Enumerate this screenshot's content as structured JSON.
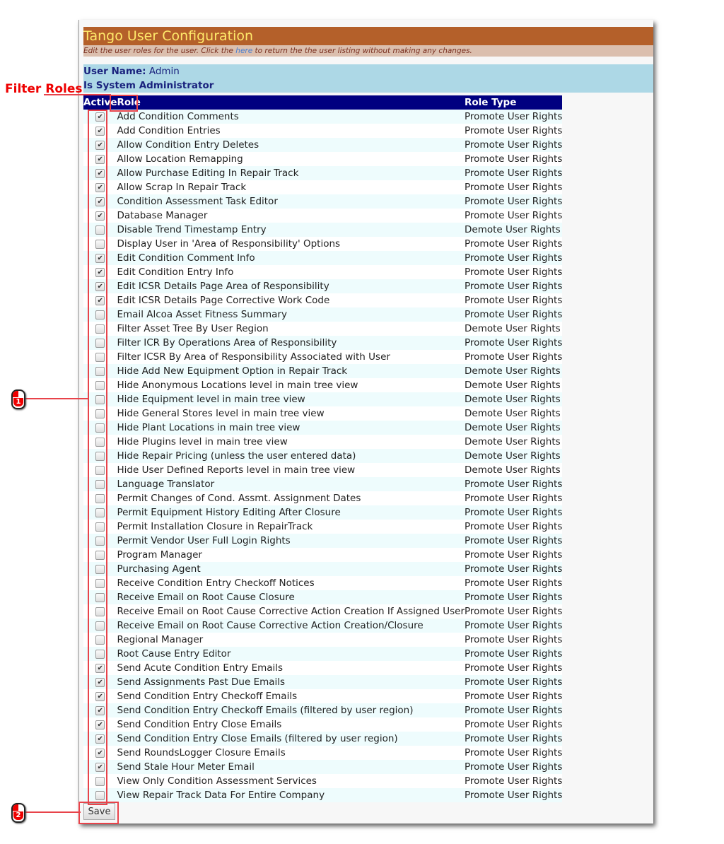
{
  "header": {
    "title": "Tango User Configuration",
    "subtitle_before": "Edit the user roles for the user. Click the ",
    "subtitle_link": "here",
    "subtitle_after": " to return the the user listing without making any changes."
  },
  "user": {
    "name_label": "User Name:",
    "name_value": "Admin",
    "sysadmin": "Is System Administrator"
  },
  "table": {
    "headers": [
      "Active",
      "Role",
      "Role Type"
    ],
    "rows": [
      [
        "Add Condition Comments",
        "Promote User Rights",
        true
      ],
      [
        "Add Condition Entries",
        "Promote User Rights",
        true
      ],
      [
        "Allow Condition Entry Deletes",
        "Promote User Rights",
        true
      ],
      [
        "Allow Location Remapping",
        "Promote User Rights",
        true
      ],
      [
        "Allow Purchase Editing In Repair Track",
        "Promote User Rights",
        true
      ],
      [
        "Allow Scrap In Repair Track",
        "Promote User Rights",
        true
      ],
      [
        "Condition Assessment Task Editor",
        "Promote User Rights",
        true
      ],
      [
        "Database Manager",
        "Promote User Rights",
        true
      ],
      [
        "Disable Trend Timestamp Entry",
        "Demote User Rights",
        false
      ],
      [
        "Display User in 'Area of Responsibility' Options",
        "Promote User Rights",
        false
      ],
      [
        "Edit Condition Comment Info",
        "Promote User Rights",
        true
      ],
      [
        "Edit Condition Entry Info",
        "Promote User Rights",
        true
      ],
      [
        "Edit ICSR Details Page Area of Responsibility",
        "Promote User Rights",
        true
      ],
      [
        "Edit ICSR Details Page Corrective Work Code",
        "Promote User Rights",
        true
      ],
      [
        "Email Alcoa Asset Fitness Summary",
        "Promote User Rights",
        false
      ],
      [
        "Filter Asset Tree By User Region",
        "Demote User Rights",
        false
      ],
      [
        "Filter ICR By Operations Area of Responsibility",
        "Promote User Rights",
        false
      ],
      [
        "Filter ICSR By Area of Responsibility Associated with User",
        "Promote User Rights",
        false
      ],
      [
        "Hide Add New Equipment Option in Repair Track",
        "Demote User Rights",
        false
      ],
      [
        "Hide Anonymous Locations level in main tree view",
        "Demote User Rights",
        false
      ],
      [
        "Hide Equipment level in main tree view",
        "Demote User Rights",
        false
      ],
      [
        "Hide General Stores level in main tree view",
        "Demote User Rights",
        false
      ],
      [
        "Hide Plant Locations in main tree view",
        "Demote User Rights",
        false
      ],
      [
        "Hide Plugins level in main tree view",
        "Demote User Rights",
        false
      ],
      [
        "Hide Repair Pricing (unless the user entered data)",
        "Demote User Rights",
        false
      ],
      [
        "Hide User Defined Reports level in main tree view",
        "Demote User Rights",
        false
      ],
      [
        "Language Translator",
        "Promote User Rights",
        false
      ],
      [
        "Permit Changes of Cond. Assmt. Assignment Dates",
        "Promote User Rights",
        false
      ],
      [
        "Permit Equipment History Editing After Closure",
        "Promote User Rights",
        false
      ],
      [
        "Permit Installation Closure in RepairTrack",
        "Promote User Rights",
        false
      ],
      [
        "Permit Vendor User Full Login Rights",
        "Promote User Rights",
        false
      ],
      [
        "Program Manager",
        "Promote User Rights",
        false
      ],
      [
        "Purchasing Agent",
        "Promote User Rights",
        false
      ],
      [
        "Receive Condition Entry Checkoff Notices",
        "Promote User Rights",
        false
      ],
      [
        "Receive Email on Root Cause Closure",
        "Promote User Rights",
        false
      ],
      [
        "Receive Email on Root Cause Corrective Action Creation If Assigned User",
        "Promote User Rights",
        false
      ],
      [
        "Receive Email on Root Cause Corrective Action Creation/Closure",
        "Promote User Rights",
        false
      ],
      [
        "Regional Manager",
        "Promote User Rights",
        false
      ],
      [
        "Root Cause Entry Editor",
        "Promote User Rights",
        false
      ],
      [
        "Send Acute Condition Entry Emails",
        "Promote User Rights",
        true
      ],
      [
        "Send Assignments Past Due Emails",
        "Promote User Rights",
        true
      ],
      [
        "Send Condition Entry Checkoff Emails",
        "Promote User Rights",
        true
      ],
      [
        "Send Condition Entry Checkoff Emails (filtered by user region)",
        "Promote User Rights",
        true
      ],
      [
        "Send Condition Entry Close Emails",
        "Promote User Rights",
        true
      ],
      [
        "Send Condition Entry Close Emails (filtered by user region)",
        "Promote User Rights",
        true
      ],
      [
        "Send RoundsLogger Closure Emails",
        "Promote User Rights",
        true
      ],
      [
        "Send Stale Hour Meter Email",
        "Promote User Rights",
        true
      ],
      [
        "View Only Condition Assessment Services",
        "Promote User Rights",
        false
      ],
      [
        "View Repair Track Data For Entire Company",
        "Promote User Rights",
        false
      ]
    ]
  },
  "save_label": "Save",
  "annotations": {
    "filter_roles": "Filter Roles",
    "step1": "1",
    "step2": "2",
    "accent": "#e8434a"
  }
}
